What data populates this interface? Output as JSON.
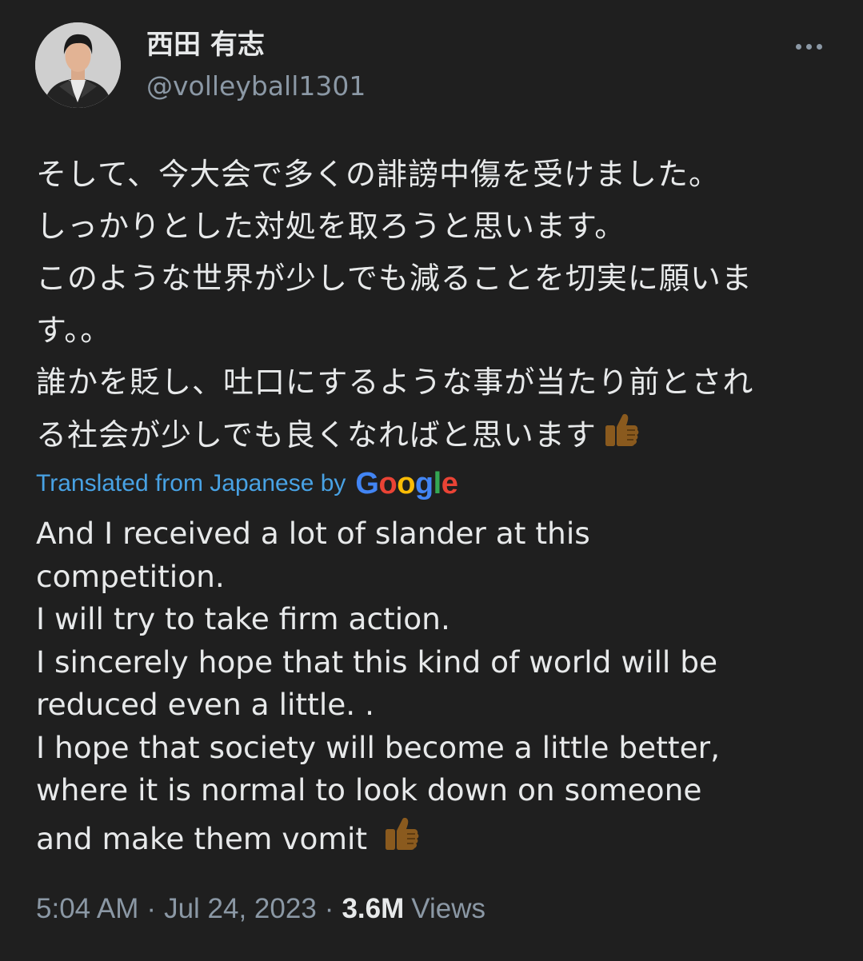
{
  "author": {
    "display_name": "西田 有志",
    "handle": "@volleyball1301"
  },
  "icons": {
    "more": "more-horizontal-icon",
    "emoji": "thumbs-up-emoji-icon",
    "avatar": "profile-photo"
  },
  "tweet": {
    "original_lines": [
      "そして、今大会で多くの誹謗中傷を受けました。",
      "しっかりとした対処を取ろうと思います。",
      "このような世界が少しでも減ることを切実に願いま",
      "す。。",
      "誰かを貶し、吐口にするような事が当たり前とされ",
      "る社会が少しでも良くなればと思います"
    ],
    "translation_label": "Translated from Japanese by",
    "translation_provider": "Google",
    "translated_lines": [
      "And I received a lot of slander at this",
      "competition.",
      "I will try to take firm action.",
      "I sincerely hope that this kind of world will be",
      "reduced even a little. .",
      "I hope that society will become a little better,",
      "where it is normal to look down on someone",
      "and make them vomit "
    ]
  },
  "meta": {
    "time": "5:04 AM",
    "separator": "·",
    "date": "Jul 24, 2023",
    "views_count": "3.6M",
    "views_label": "Views"
  },
  "colors": {
    "background": "#1f1f1f",
    "primary_text": "#e7e9ea",
    "secondary_text": "#8b98a5",
    "link": "#48a2e4",
    "emoji": "#8a5a1e",
    "google_blue": "#4285f4",
    "google_red": "#ea4335",
    "google_yellow": "#fbbc05",
    "google_green": "#34a853"
  }
}
